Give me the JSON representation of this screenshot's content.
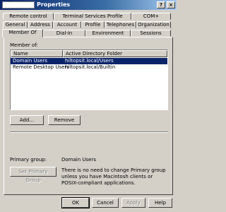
{
  "window": {
    "title": "Properties"
  },
  "titlebar_buttons": {
    "help": "?",
    "close": "×"
  },
  "tabs": {
    "row1": [
      "Remote control",
      "Terminal Services Profile",
      "COM+"
    ],
    "row2": [
      "General",
      "Address",
      "Account",
      "Profile",
      "Telephones",
      "Organization"
    ],
    "row3": [
      "Member Of",
      "Dial-in",
      "Environment",
      "Sessions"
    ]
  },
  "member_of_label": "Member of:",
  "list": {
    "columns": [
      "Name",
      "Active Directory Folder"
    ],
    "rows": [
      {
        "name": "Domain Users",
        "folder": "hiltopsit.local/Users",
        "selected": true
      },
      {
        "name": "Remote Desktop Users",
        "folder": "hiltopsit.local/Builtin",
        "selected": false
      }
    ]
  },
  "buttons": {
    "add": "Add...",
    "remove": "Remove",
    "set_primary": "Set Primary Group",
    "ok": "OK",
    "cancel": "Cancel",
    "apply": "Apply",
    "help": "Help"
  },
  "primary_group": {
    "label": "Primary group:",
    "value": "Domain Users"
  },
  "hint": "There is no need to change Primary group unless you have Macintosh clients or POSIX-compliant applications.",
  "colors": {
    "face": "#d4d0c8",
    "title_start": "#0a246a",
    "selection": "#0a246a"
  }
}
